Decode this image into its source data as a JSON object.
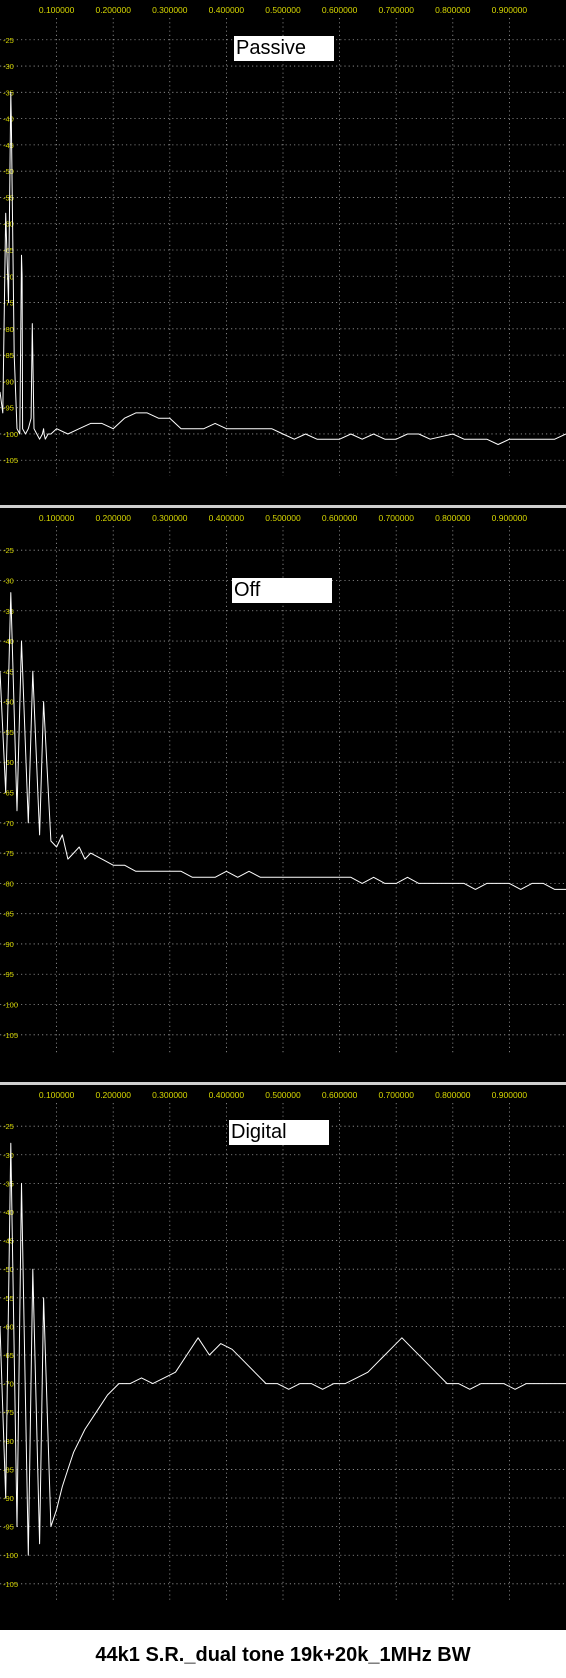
{
  "caption": "44k1 S.R._dual tone 19k+20k_1MHz BW",
  "colors": {
    "background": "#000000",
    "trace": "#ffffff",
    "tick_labels": "#d8d800",
    "grid": "#9a9a9a"
  },
  "chart_data": [
    {
      "type": "line",
      "title": "Passive",
      "xlim": [
        0,
        1.0
      ],
      "ylim": [
        -108,
        -22
      ],
      "x_ticks": [
        "0.100000",
        "0.200000",
        "0.300000",
        "0.400000",
        "0.500000",
        "0.600000",
        "0.700000",
        "0.800000",
        "0.900000"
      ],
      "y_ticks": [
        "-25",
        "-30",
        "-35",
        "-40",
        "-45",
        "-50",
        "-55",
        "-60",
        "-65",
        "-70",
        "-75",
        "-80",
        "-85",
        "-90",
        "-95",
        "-100",
        "-105"
      ],
      "grid": true,
      "series": [
        {
          "x": [
            0,
            0.005,
            0.01,
            0.015,
            0.019,
            0.02,
            0.025,
            0.03,
            0.035,
            0.038,
            0.039,
            0.04,
            0.045,
            0.05,
            0.055,
            0.057,
            0.058,
            0.06,
            0.065,
            0.07,
            0.075,
            0.077,
            0.078,
            0.08,
            0.085,
            0.09,
            0.1,
            0.12,
            0.14,
            0.16,
            0.18,
            0.2,
            0.22,
            0.24,
            0.26,
            0.28,
            0.3,
            0.32,
            0.34,
            0.36,
            0.38,
            0.4,
            0.42,
            0.44,
            0.46,
            0.48,
            0.5,
            0.52,
            0.54,
            0.56,
            0.58,
            0.6,
            0.62,
            0.64,
            0.66,
            0.68,
            0.7,
            0.72,
            0.74,
            0.76,
            0.8,
            0.82,
            0.84,
            0.86,
            0.88,
            0.9,
            0.92,
            0.94,
            0.96,
            0.98,
            1.0
          ],
          "y": [
            -92,
            -96,
            -58,
            -75,
            -35,
            -40,
            -85,
            -99,
            -100,
            -66,
            -70,
            -99,
            -100,
            -99,
            -97,
            -79,
            -85,
            -99,
            -100,
            -101,
            -100,
            -99,
            -100,
            -101,
            -100,
            -100,
            -99,
            -100,
            -99,
            -98,
            -98,
            -99,
            -97,
            -96,
            -96,
            -97,
            -97,
            -99,
            -99,
            -99,
            -98,
            -99,
            -99,
            -99,
            -99,
            -99,
            -100,
            -101,
            -100,
            -101,
            -101,
            -101,
            -100,
            -101,
            -100,
            -101,
            -101,
            -100,
            -100,
            -101,
            -100,
            -101,
            -101,
            -101,
            -102,
            -101,
            -101,
            -101,
            -101,
            -101,
            -100
          ]
        }
      ]
    },
    {
      "type": "line",
      "title": "Off",
      "xlim": [
        0,
        1.0
      ],
      "ylim": [
        -108,
        -22
      ],
      "x_ticks": [
        "0.100000",
        "0.200000",
        "0.300000",
        "0.400000",
        "0.500000",
        "0.600000",
        "0.700000",
        "0.800000",
        "0.900000"
      ],
      "y_ticks": [
        "-25",
        "-30",
        "-35",
        "-40",
        "-45",
        "-50",
        "-55",
        "-60",
        "-65",
        "-70",
        "-75",
        "-80",
        "-85",
        "-90",
        "-95",
        "-100",
        "-105"
      ],
      "grid": true,
      "series": [
        {
          "x": [
            0,
            0.01,
            0.019,
            0.03,
            0.038,
            0.05,
            0.058,
            0.07,
            0.077,
            0.09,
            0.1,
            0.11,
            0.12,
            0.13,
            0.14,
            0.15,
            0.16,
            0.18,
            0.2,
            0.22,
            0.24,
            0.26,
            0.28,
            0.3,
            0.32,
            0.34,
            0.36,
            0.38,
            0.4,
            0.42,
            0.44,
            0.46,
            0.48,
            0.5,
            0.52,
            0.54,
            0.56,
            0.58,
            0.6,
            0.62,
            0.64,
            0.66,
            0.68,
            0.7,
            0.72,
            0.74,
            0.76,
            0.78,
            0.8,
            0.82,
            0.84,
            0.86,
            0.88,
            0.9,
            0.92,
            0.94,
            0.96,
            0.98,
            1.0
          ],
          "y": [
            -45,
            -65,
            -32,
            -68,
            -40,
            -70,
            -45,
            -72,
            -50,
            -73,
            -74,
            -72,
            -76,
            -75,
            -74,
            -76,
            -75,
            -76,
            -77,
            -77,
            -78,
            -78,
            -78,
            -78,
            -78,
            -79,
            -79,
            -79,
            -78,
            -79,
            -78,
            -79,
            -79,
            -79,
            -79,
            -79,
            -79,
            -79,
            -79,
            -79,
            -80,
            -79,
            -80,
            -80,
            -79,
            -80,
            -80,
            -80,
            -80,
            -80,
            -81,
            -80,
            -80,
            -80,
            -81,
            -80,
            -80,
            -81,
            -81
          ]
        }
      ]
    },
    {
      "type": "line",
      "title": "Digital",
      "xlim": [
        0,
        1.0
      ],
      "ylim": [
        -108,
        -22
      ],
      "x_ticks": [
        "0.100000",
        "0.200000",
        "0.300000",
        "0.400000",
        "0.500000",
        "0.600000",
        "0.700000",
        "0.800000",
        "0.900000"
      ],
      "y_ticks": [
        "-25",
        "-30",
        "-35",
        "-40",
        "-45",
        "-50",
        "-55",
        "-60",
        "-65",
        "-70",
        "-75",
        "-80",
        "-85",
        "-90",
        "-95",
        "-100",
        "-105"
      ],
      "grid": true,
      "series": [
        {
          "x": [
            0,
            0.01,
            0.019,
            0.03,
            0.038,
            0.05,
            0.058,
            0.07,
            0.077,
            0.09,
            0.1,
            0.11,
            0.12,
            0.13,
            0.15,
            0.17,
            0.19,
            0.21,
            0.23,
            0.25,
            0.27,
            0.29,
            0.31,
            0.33,
            0.35,
            0.37,
            0.39,
            0.41,
            0.43,
            0.45,
            0.47,
            0.49,
            0.51,
            0.53,
            0.55,
            0.57,
            0.59,
            0.61,
            0.63,
            0.65,
            0.67,
            0.69,
            0.71,
            0.73,
            0.75,
            0.77,
            0.79,
            0.81,
            0.83,
            0.85,
            0.87,
            0.89,
            0.91,
            0.93,
            0.95,
            0.97,
            1.0
          ],
          "y": [
            -60,
            -90,
            -28,
            -95,
            -35,
            -100,
            -50,
            -98,
            -55,
            -95,
            -92,
            -88,
            -85,
            -82,
            -78,
            -75,
            -72,
            -70,
            -70,
            -69,
            -70,
            -69,
            -68,
            -65,
            -62,
            -65,
            -63,
            -64,
            -66,
            -68,
            -70,
            -70,
            -71,
            -70,
            -70,
            -71,
            -70,
            -70,
            -69,
            -68,
            -66,
            -64,
            -62,
            -64,
            -66,
            -68,
            -70,
            -70,
            -71,
            -70,
            -70,
            -70,
            -71,
            -70,
            -70,
            -70,
            -70
          ]
        }
      ]
    }
  ]
}
